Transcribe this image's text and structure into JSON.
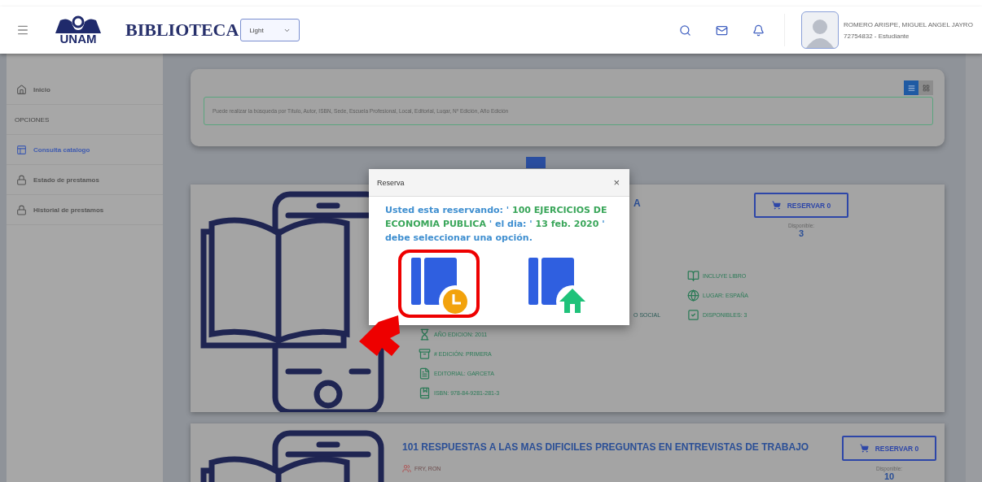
{
  "header": {
    "logo_text": "UNAM",
    "brand": "BIBLIOTECA",
    "theme_select": "Light",
    "user": {
      "name": "ROMERO ARISPE, MIGUEL ANGEL JAYRO",
      "detail": "72754832 - Estudiante"
    }
  },
  "sidebar": {
    "items": [
      {
        "kind": "link",
        "label": "Inicio",
        "selected": false
      },
      {
        "kind": "section",
        "label": "OPCIONES"
      },
      {
        "kind": "link",
        "label": "Consulta catalogo",
        "selected": true
      },
      {
        "kind": "link",
        "label": "Estado de prestamos",
        "selected": false
      },
      {
        "kind": "link",
        "label": "Historial de prestamos",
        "selected": false
      }
    ]
  },
  "search": {
    "placeholder": "Puede realizar la búsqueda por Título, Autor, ISBN, Sede, Escuela Profesional, Local, Editorial, Lugar, Nº Edición, Año Edición",
    "views": [
      {
        "kind": "list",
        "selected": true
      },
      {
        "kind": "grid",
        "selected": false
      }
    ]
  },
  "pagination": {
    "pages": [
      {
        "selected": true
      }
    ]
  },
  "books": [
    {
      "title": "A",
      "left_details": [
        "AÑO EDICION: 2011",
        "# EDICIÓN: PRIMERA",
        "EDITORIAL: GARCETA",
        "ISBN: 978-84-9281-281-3"
      ],
      "middle_fragment": "O SOCIAL",
      "right_details": [
        "INCLUYE LIBRO",
        "LUGAR: ESPAÑA",
        "DISPONIBLES: 3"
      ],
      "reserve_label": "RESERVAR 0",
      "available_label": "Disponible:",
      "available": "3"
    },
    {
      "title": "101 RESPUESTAS A LAS MAS DIFICILES PREGUNTAS EN ENTREVISTAS DE TRABAJO",
      "author": "FRY, RON",
      "reserve_label": "RESERVAR 0",
      "available_label": "Disponible:",
      "available": "10"
    }
  ],
  "modal": {
    "title": "Reserva",
    "close": "×",
    "message": [
      {
        "kind": "plain",
        "text": "Usted esta reservando: '"
      },
      {
        "kind": "highlight",
        "text": " 100 EJERCICIOS DE ECONOMIA PUBLICA "
      },
      {
        "kind": "plain",
        "text": "' el dia: '"
      },
      {
        "kind": "highlight",
        "text": " 13 feb. 2020 "
      },
      {
        "kind": "plain",
        "text": "' debe seleccionar una opción."
      }
    ],
    "options": [
      {
        "kind": "pickup_later",
        "selected": true
      },
      {
        "kind": "home_delivery",
        "selected": false
      }
    ]
  }
}
